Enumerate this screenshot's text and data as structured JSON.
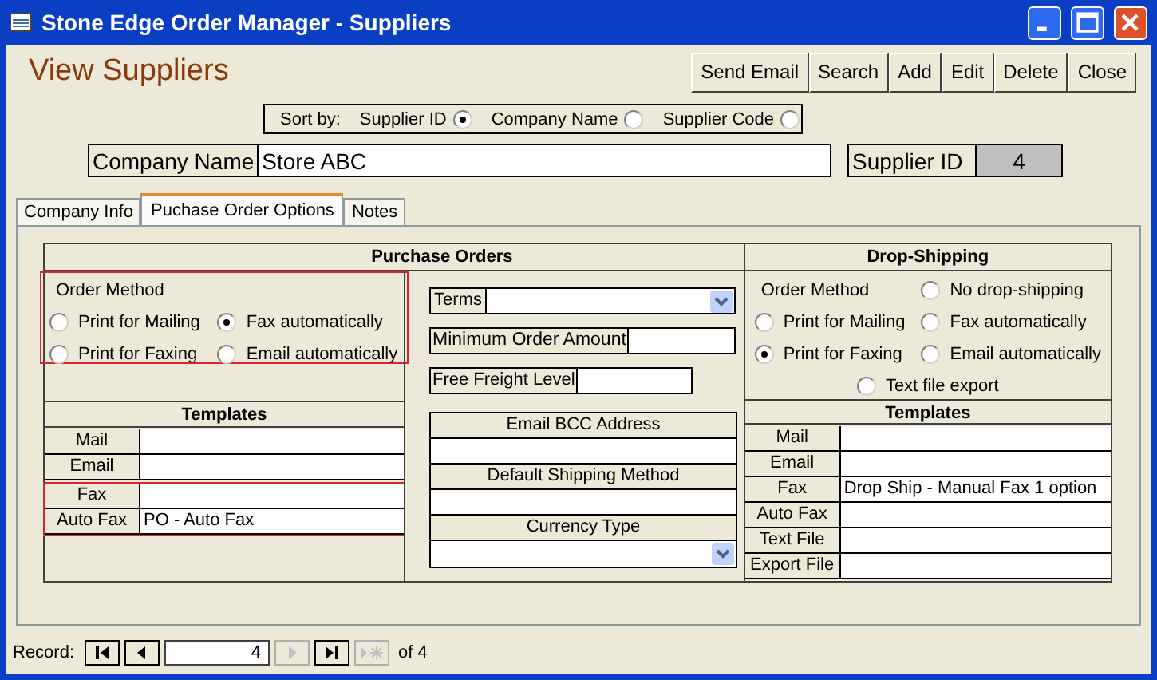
{
  "window": {
    "title": "Stone Edge Order Manager - Suppliers"
  },
  "header": {
    "title": "View Suppliers"
  },
  "buttons": [
    {
      "label": "Send Email"
    },
    {
      "label": "Search"
    },
    {
      "label": "Add"
    },
    {
      "label": "Edit"
    },
    {
      "label": "Delete"
    },
    {
      "label": "Close"
    }
  ],
  "sort": {
    "label": "Sort by:",
    "options": [
      {
        "label": "Supplier ID",
        "selected": true
      },
      {
        "label": "Company Name",
        "selected": false
      },
      {
        "label": "Supplier Code",
        "selected": false
      }
    ]
  },
  "company_name": {
    "label": "Company Name",
    "value": "Store ABC"
  },
  "supplier_id": {
    "label": "Supplier ID",
    "value": "4"
  },
  "tabs": [
    {
      "label": "Company Info",
      "selected": false
    },
    {
      "label": "Puchase Order Options",
      "selected": true
    },
    {
      "label": "Notes",
      "selected": false
    }
  ],
  "purchase_orders": {
    "title": "Purchase Orders",
    "order_method": {
      "label": "Order Method",
      "highlighted": true,
      "options": [
        {
          "label": "Print for Mailing",
          "selected": false
        },
        {
          "label": "Fax automatically",
          "selected": true
        },
        {
          "label": "Print for Faxing",
          "selected": false
        },
        {
          "label": "Email automatically",
          "selected": false
        }
      ]
    },
    "templates": {
      "title": "Templates",
      "rows": [
        {
          "label": "Mail",
          "value": "",
          "highlighted": false
        },
        {
          "label": "Email",
          "value": "",
          "highlighted": false
        },
        {
          "label": "Fax",
          "value": "",
          "highlighted": true
        },
        {
          "label": "Auto Fax",
          "value": "PO - Auto Fax",
          "highlighted": true
        }
      ]
    }
  },
  "orders": {
    "terms": {
      "label": "Terms"
    },
    "minimum_order_amount": {
      "label": "Minimum Order Amount"
    },
    "free_freight_level": {
      "label": "Free Freight Level"
    },
    "stacked_fields": [
      {
        "label": "Email BCC Address",
        "kind": "text"
      },
      {
        "label": "Default Shipping Method",
        "kind": "text"
      },
      {
        "label": "Currency Type",
        "kind": "combo"
      }
    ]
  },
  "drop_shipping": {
    "title": "Drop-Shipping",
    "order_method": {
      "label": "Order Method",
      "highlighted": false,
      "options": [
        {
          "label": "No drop-shipping",
          "selected": false
        },
        {
          "label": "Print for Mailing",
          "selected": false
        },
        {
          "label": "Fax automatically",
          "selected": false
        },
        {
          "label": "Print for Faxing",
          "selected": true
        },
        {
          "label": "Email automatically",
          "selected": false
        },
        {
          "label": "Text file export",
          "selected": false
        }
      ]
    },
    "templates": {
      "title": "Templates",
      "rows": [
        {
          "label": "Mail",
          "value": "",
          "highlighted": false
        },
        {
          "label": "Email",
          "value": "",
          "highlighted": false
        },
        {
          "label": "Fax",
          "value": "Drop Ship - Manual Fax 1 option",
          "highlighted": false
        },
        {
          "label": "Auto Fax",
          "value": "",
          "highlighted": false
        },
        {
          "label": "Text File",
          "value": "",
          "highlighted": false
        },
        {
          "label": "Export File",
          "value": "",
          "highlighted": false
        }
      ]
    }
  },
  "record_nav": {
    "label": "Record:",
    "current": "4",
    "total": "of 4"
  }
}
